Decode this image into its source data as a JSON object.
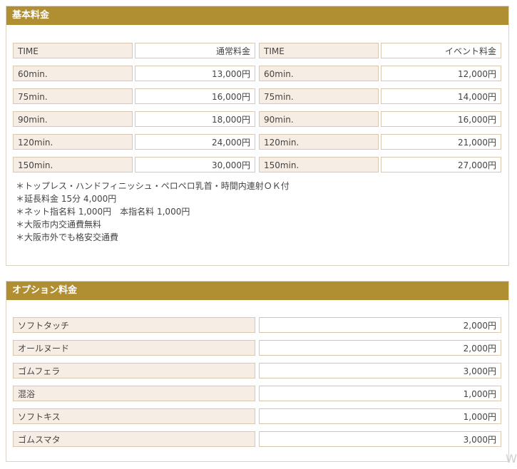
{
  "basic": {
    "title": "基本料金",
    "rows": [
      [
        "TIME",
        "通常料金",
        "TIME",
        "イベント料金"
      ],
      [
        "60min.",
        "13,000円",
        "60min.",
        "12,000円"
      ],
      [
        "75min.",
        "16,000円",
        "75min.",
        "14,000円"
      ],
      [
        "90min.",
        "18,000円",
        "90min.",
        "16,000円"
      ],
      [
        "120min.",
        "24,000円",
        "120min.",
        "21,000円"
      ],
      [
        "150min.",
        "30,000円",
        "150min.",
        "27,000円"
      ]
    ],
    "notes": [
      "＊トップレス・ハンドフィニッシュ・ペロペロ乳首・時間内連射ＯＫ付",
      "＊延長料金 15分 4,000円",
      "＊ネット指名料 1,000円　本指名料 1,000円",
      "＊大阪市内交通費無料",
      "＊大阪市外でも格安交通費"
    ]
  },
  "options": {
    "title": "オプション料金",
    "rows": [
      [
        "ソフトタッチ",
        "2,000円"
      ],
      [
        "オールヌード",
        "2,000円"
      ],
      [
        "ゴムフェラ",
        "3,000円"
      ],
      [
        "混浴",
        "1,000円"
      ],
      [
        "ソフトキス",
        "1,000円"
      ],
      [
        "ゴムスマタ",
        "3,000円"
      ]
    ]
  },
  "watermark": "W"
}
